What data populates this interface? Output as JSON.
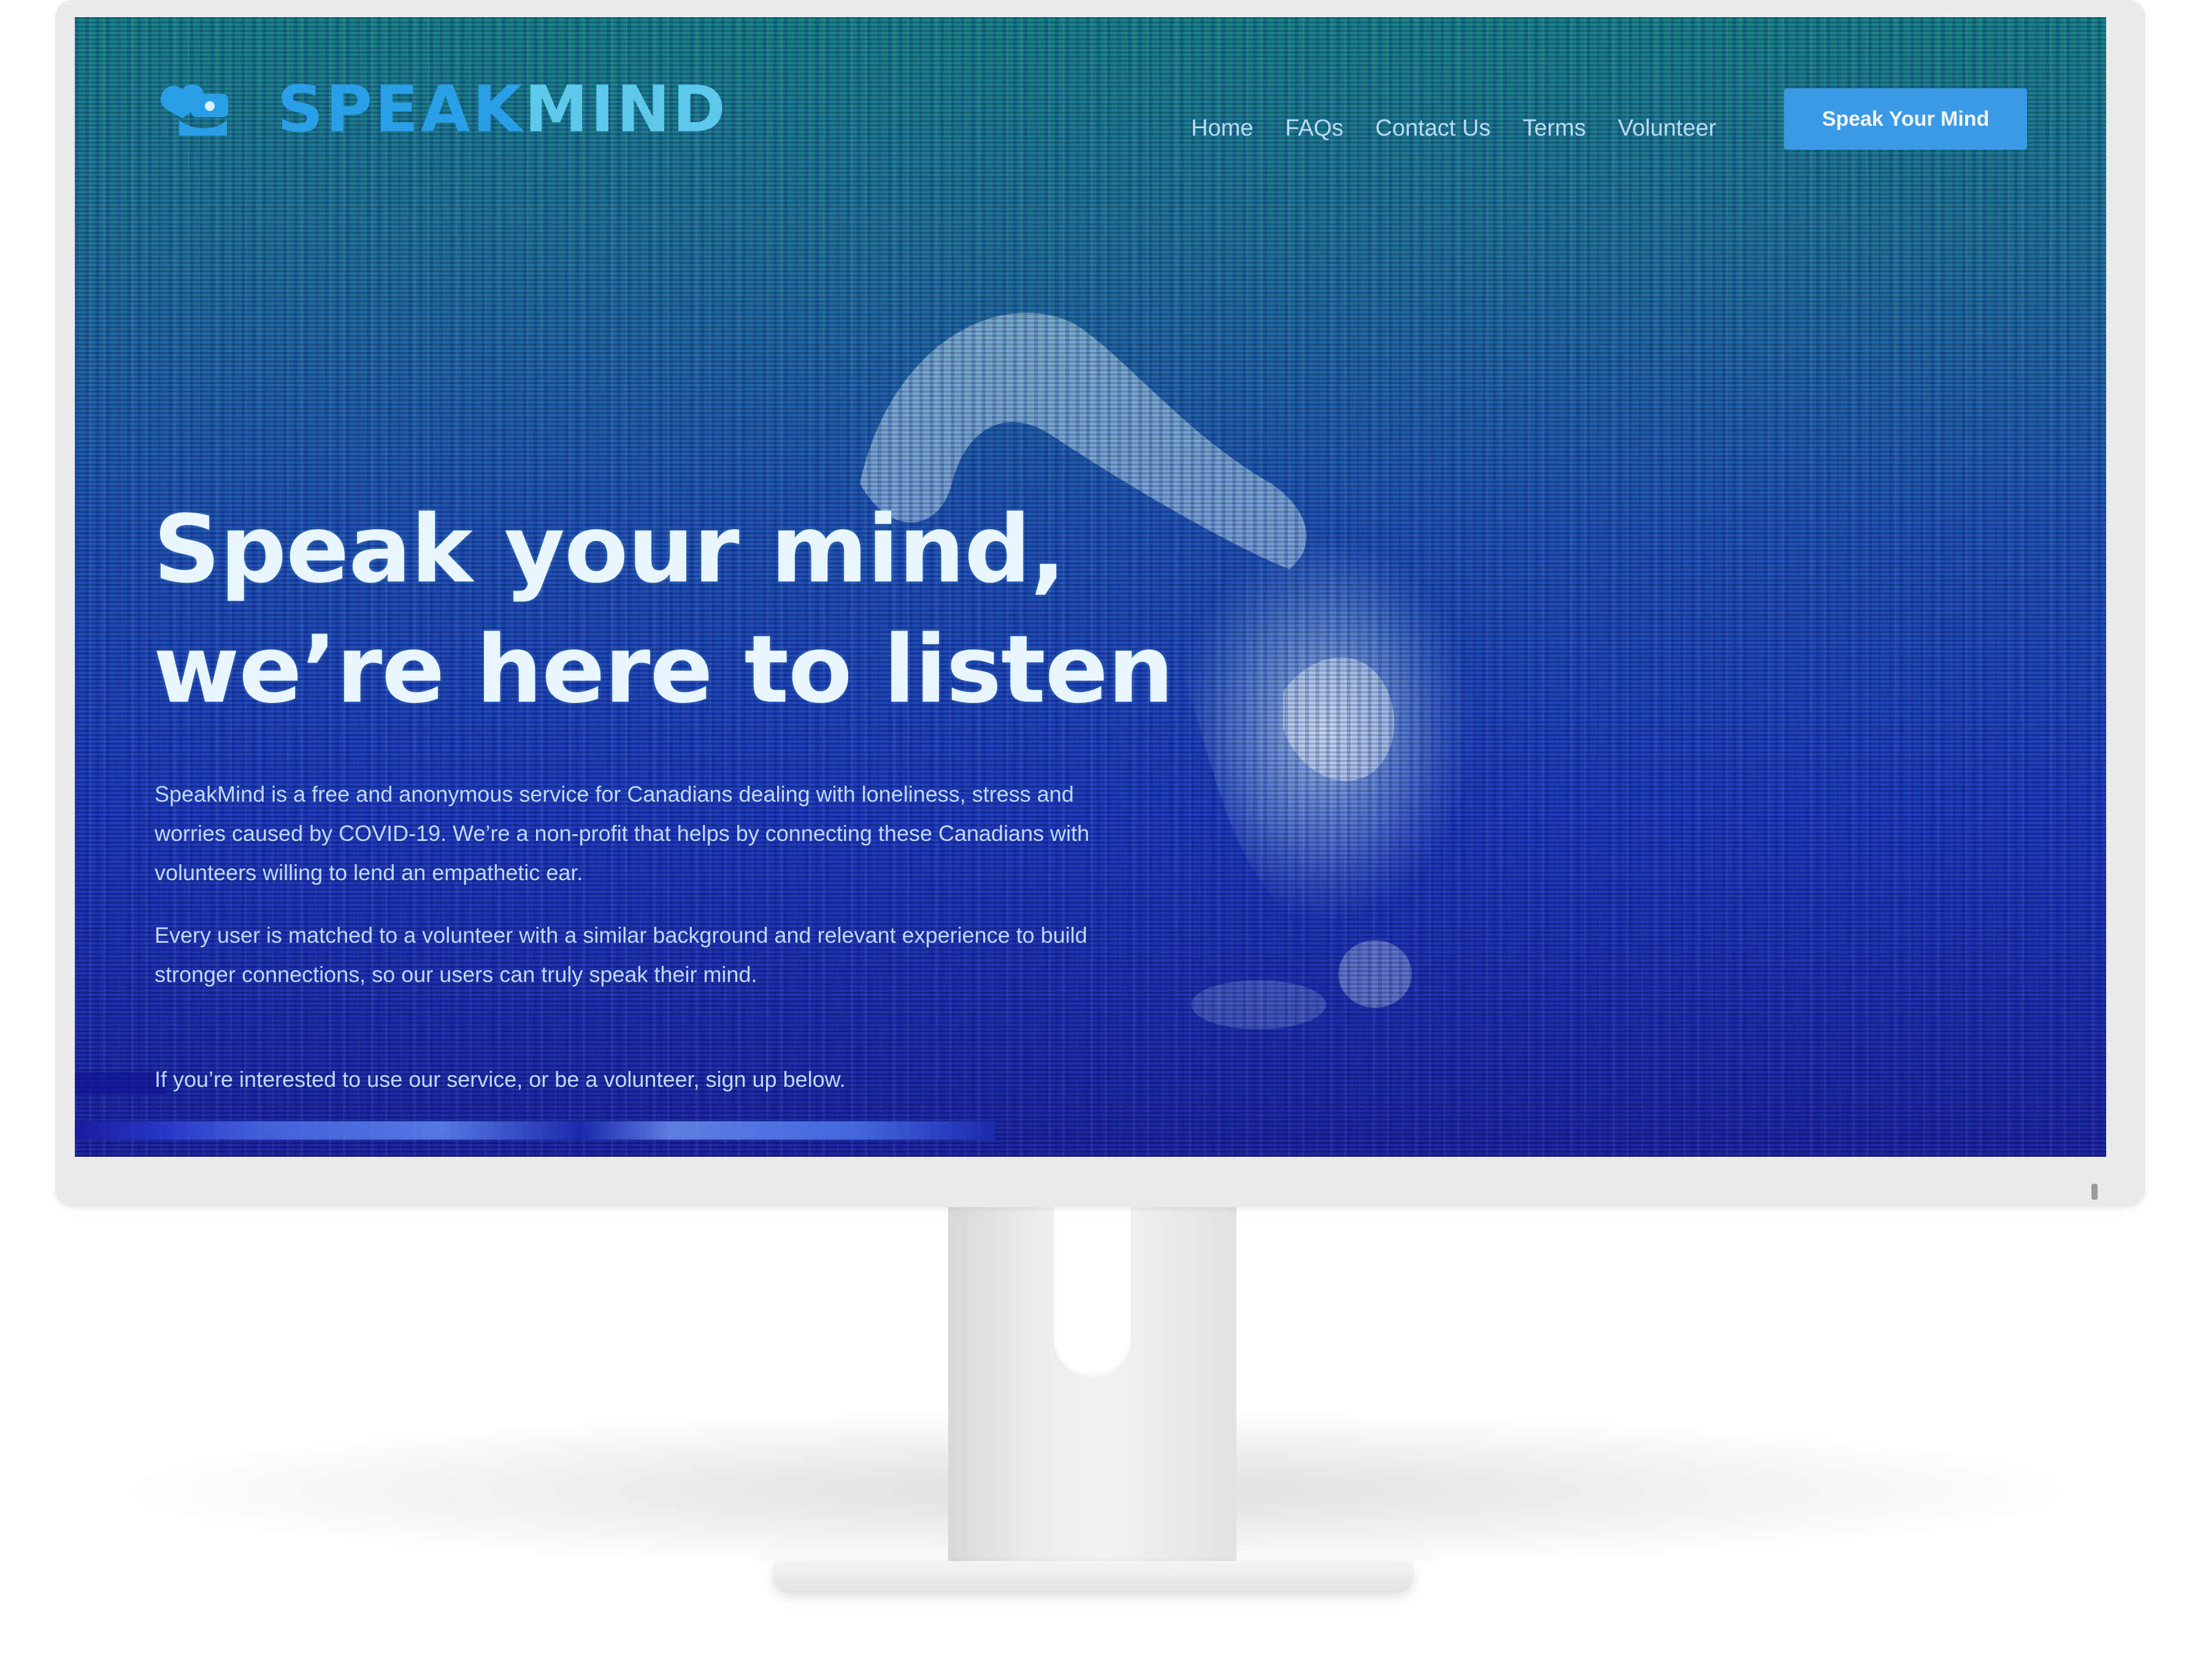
{
  "brand": {
    "logo_speak": "SPEAK",
    "logo_mind": "MIND",
    "logo_icon": "hand-heart-icon"
  },
  "nav": {
    "items": [
      {
        "label": "Home"
      },
      {
        "label": "FAQs"
      },
      {
        "label": "Contact Us"
      },
      {
        "label": "Terms"
      },
      {
        "label": "Volunteer"
      }
    ],
    "cta_label": "Speak Your Mind"
  },
  "hero": {
    "headline": "Speak your mind, we’re here to listen",
    "paragraph_1": "SpeakMind is a free and anonymous service for Canadians dealing with loneliness, stress and worries caused by COVID-19. We’re a non-profit that helps by connecting these Canadians with volunteers willing to lend an empathetic ear.",
    "paragraph_2": "Every user is matched to a volunteer with a similar background and relevant experience to build stronger connections, so our users can truly speak their mind.",
    "paragraph_3": "If you’re interested to use our service, or be a volunteer, sign up below."
  },
  "colors": {
    "accent": "#3c9ded",
    "logo_speak": "#2a9fe8",
    "logo_mind": "#5ec8ea",
    "monitor_frame": "#ebebeb"
  }
}
